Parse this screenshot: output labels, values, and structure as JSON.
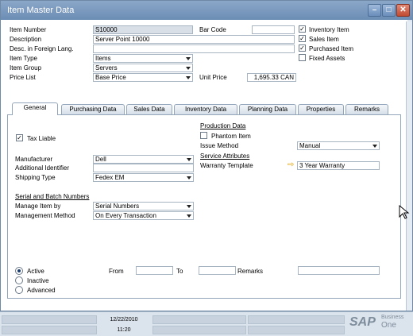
{
  "window": {
    "title": "Item Master Data"
  },
  "header": {
    "item_number_label": "Item Number",
    "item_number_value": "S10000",
    "barcode_label": "Bar Code",
    "barcode_value": "",
    "description_label": "Description",
    "description_value": "Server Point 10000",
    "desc_foreign_label": "Desc. in Foreign Lang.",
    "desc_foreign_value": "",
    "item_type_label": "Item Type",
    "item_type_value": "Items",
    "item_group_label": "Item Group",
    "item_group_value": "Servers",
    "price_list_label": "Price List",
    "price_list_value": "Base Price",
    "unit_price_label": "Unit Price",
    "unit_price_value": "1,695.33 CAN"
  },
  "checks": {
    "inventory_item": {
      "label": "Inventory Item",
      "checked": true
    },
    "sales_item": {
      "label": "Sales Item",
      "checked": true
    },
    "purchased_item": {
      "label": "Purchased Item",
      "checked": true
    },
    "fixed_assets": {
      "label": "Fixed Assets",
      "checked": false
    }
  },
  "tabs": [
    "General",
    "Purchasing Data",
    "Sales Data",
    "Inventory Data",
    "Planning Data",
    "Properties",
    "Remarks"
  ],
  "general": {
    "tax_liable_label": "Tax Liable",
    "manufacturer_label": "Manufacturer",
    "manufacturer_value": "Dell",
    "additional_id_label": "Additional Identifier",
    "additional_id_value": "",
    "shipping_type_label": "Shipping Type",
    "shipping_type_value": "Fedex EM",
    "serial_batch_header": "Serial and Batch Numbers",
    "manage_item_by_label": "Manage Item by",
    "manage_item_by_value": "Serial Numbers",
    "management_method_label": "Management Method",
    "management_method_value": "On Every Transaction",
    "production_data_header": "Production Data",
    "phantom_item_label": "Phantom Item",
    "issue_method_label": "Issue Method",
    "issue_method_value": "Manual",
    "service_attributes_header": "Service Attributes",
    "warranty_template_label": "Warranty Template",
    "warranty_template_value": "3 Year Warranty",
    "status_active": "Active",
    "status_inactive": "Inactive",
    "status_advanced": "Advanced",
    "from_label": "From",
    "to_label": "To",
    "remarks_label": "Remarks"
  },
  "statusbar": {
    "date": "12/22/2010",
    "time": "11:20"
  },
  "logo": {
    "brand": "SAP",
    "line1": "Business",
    "line2": "One",
    "color": "#1a6fc4"
  }
}
